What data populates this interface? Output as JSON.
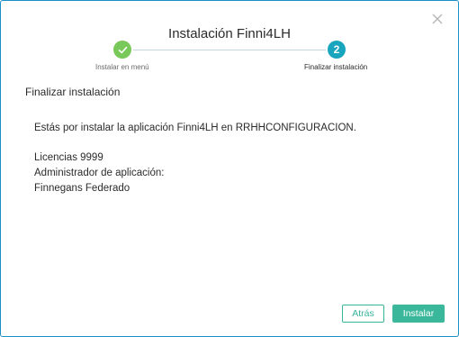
{
  "dialog": {
    "title": "Instalación Finni4LH",
    "close_icon": "close-icon"
  },
  "stepper": {
    "steps": [
      {
        "number": "1",
        "label": "Instalar en menú",
        "status": "completed",
        "icon": "checkmark-icon",
        "color": "#78c85a"
      },
      {
        "number": "2",
        "label": "Finalizar instalación",
        "status": "active",
        "color": "#1aa5bf"
      }
    ]
  },
  "content": {
    "section_title": "Finalizar instalación",
    "message": "Estás por instalar la aplicación Finni4LH en RRHHCONFIGURACION.",
    "licenses": "Licencias 9999",
    "admin_label": "Administrador de aplicación:",
    "admin_value": "Finnegans Federado"
  },
  "footer": {
    "back_label": "Atrás",
    "install_label": "Instalar",
    "accent_color": "#3bb89b"
  }
}
